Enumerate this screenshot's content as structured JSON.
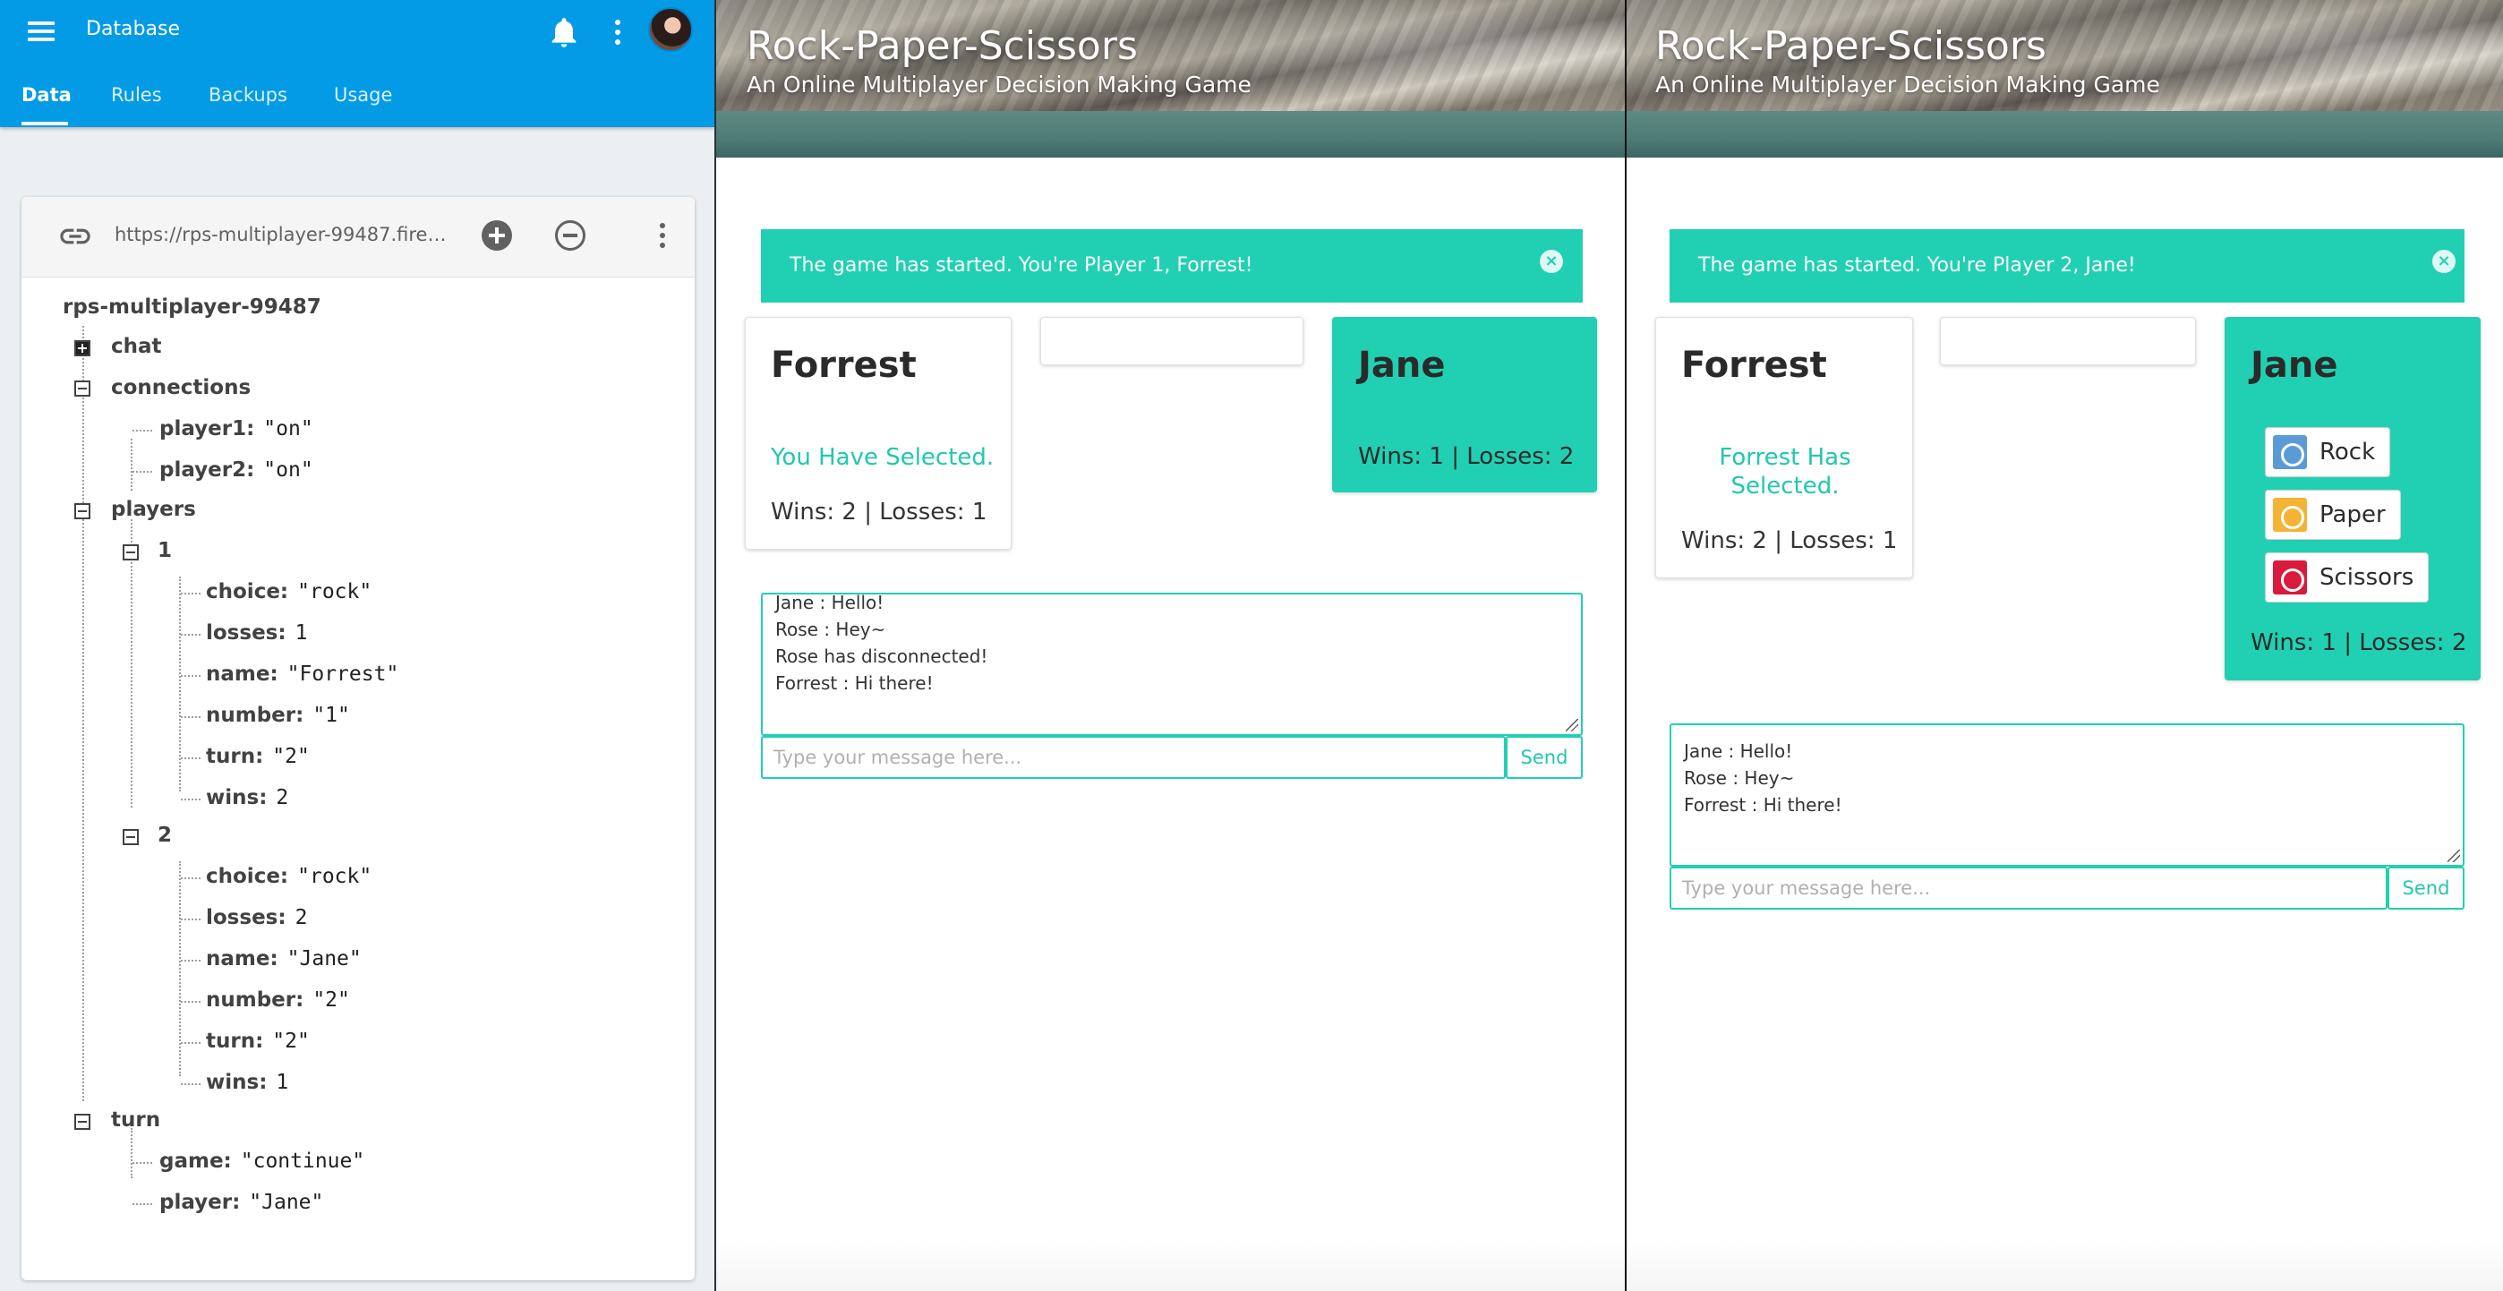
{
  "firebase": {
    "title": "Database",
    "tabs": [
      "Data",
      "Rules",
      "Backups",
      "Usage"
    ],
    "url": "https://rps-multiplayer-99487.fireba...",
    "tree": {
      "root": "rps-multiplayer-99487",
      "chat": "chat",
      "connections": "connections",
      "connections_player1_key": "player1:",
      "connections_player1_val": "\"on\"",
      "connections_player2_key": "player2:",
      "connections_player2_val": "\"on\"",
      "players": "players",
      "p1": {
        "id": "1",
        "choice_key": "choice:",
        "choice_val": "\"rock\"",
        "losses_key": "losses:",
        "losses_val": "1",
        "name_key": "name:",
        "name_val": "\"Forrest\"",
        "number_key": "number:",
        "number_val": "\"1\"",
        "turn_key": "turn:",
        "turn_val": "\"2\"",
        "wins_key": "wins:",
        "wins_val": "2"
      },
      "p2": {
        "id": "2",
        "choice_key": "choice:",
        "choice_val": "\"rock\"",
        "losses_key": "losses:",
        "losses_val": "2",
        "name_key": "name:",
        "name_val": "\"Jane\"",
        "number_key": "number:",
        "number_val": "\"2\"",
        "turn_key": "turn:",
        "turn_val": "\"2\"",
        "wins_key": "wins:",
        "wins_val": "1"
      },
      "turn": "turn",
      "turn_game_key": "game:",
      "turn_game_val": "\"continue\"",
      "turn_player_key": "player:",
      "turn_player_val": "\"Jane\""
    }
  },
  "game1": {
    "title": "Rock-Paper-Scissors",
    "subtitle": "An Online Multiplayer Decision Making Game",
    "alert": "The game has started. You're Player 1, Forrest!",
    "close": "×",
    "player1": {
      "name": "Forrest",
      "status": "You Have Selected.",
      "stats": "Wins: 2 | Losses: 1"
    },
    "player2": {
      "name": "Jane",
      "stats": "Wins: 1 | Losses: 2"
    },
    "chat": [
      "Jane : Hello!",
      "Rose : Hey~",
      "Rose has disconnected!",
      "Forrest : Hi there!"
    ],
    "input_placeholder": "Type your message here...",
    "send": "Send"
  },
  "game2": {
    "title": "Rock-Paper-Scissors",
    "subtitle": "An Online Multiplayer Decision Making Game",
    "alert": "The game has started. You're Player 2, Jane!",
    "close": "×",
    "player1": {
      "name": "Forrest",
      "status_line1": "Forrest Has",
      "status_line2": "Selected.",
      "stats": "Wins: 2 | Losses: 1"
    },
    "player2": {
      "name": "Jane",
      "stats": "Wins: 1 | Losses: 2"
    },
    "choices": [
      {
        "label": "Rock",
        "color": "#5b9bd5"
      },
      {
        "label": "Paper",
        "color": "#f5b335"
      },
      {
        "label": "Scissors",
        "color": "#d81b3c"
      }
    ],
    "chat": [
      "Jane : Hello!",
      "Rose : Hey~",
      "Forrest : Hi there!"
    ],
    "input_placeholder": "Type your message here...",
    "send": "Send"
  },
  "colors": {
    "accent": "#21d0b2",
    "firebase_blue": "#039be5"
  }
}
